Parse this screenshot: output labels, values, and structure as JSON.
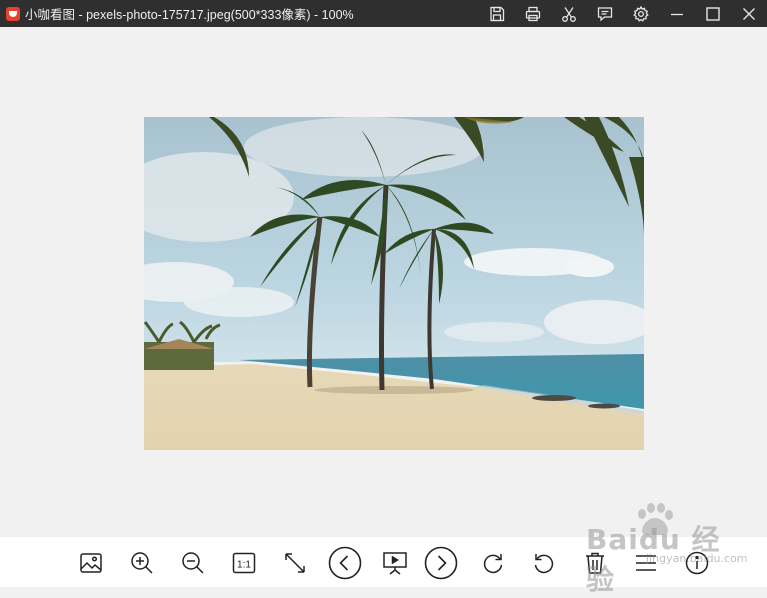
{
  "window": {
    "title": "小咖看图 - pexels-photo-175717.jpeg(500*333像素) - 100%"
  },
  "title_actions": [
    {
      "icon": "save-icon"
    },
    {
      "icon": "print-icon"
    },
    {
      "icon": "scissors-icon"
    },
    {
      "icon": "comment-icon"
    },
    {
      "icon": "gear-icon"
    },
    {
      "icon": "minimize-icon"
    },
    {
      "icon": "maximize-icon"
    },
    {
      "icon": "close-icon"
    }
  ],
  "image": {
    "description_icon": "beach-photo"
  },
  "toolbar": [
    {
      "icon": "picture-icon"
    },
    {
      "icon": "zoom-in-icon"
    },
    {
      "icon": "zoom-out-icon"
    },
    {
      "icon": "actual-size-icon",
      "label": "1:1"
    },
    {
      "icon": "fit-window-icon"
    },
    {
      "icon": "previous-icon"
    },
    {
      "icon": "slideshow-icon"
    },
    {
      "icon": "next-icon"
    },
    {
      "icon": "rotate-right-icon"
    },
    {
      "icon": "rotate-left-icon"
    },
    {
      "icon": "delete-icon"
    },
    {
      "icon": "menu-icon"
    },
    {
      "icon": "info-icon"
    }
  ],
  "watermark": {
    "brand": "Baidu 经验",
    "sub": "jingyan.baidu.com"
  },
  "colors": {
    "titlebar": "#2f2f2f",
    "viewer_bg": "#f1f1f1",
    "toolbar_bg": "#ffffff"
  }
}
